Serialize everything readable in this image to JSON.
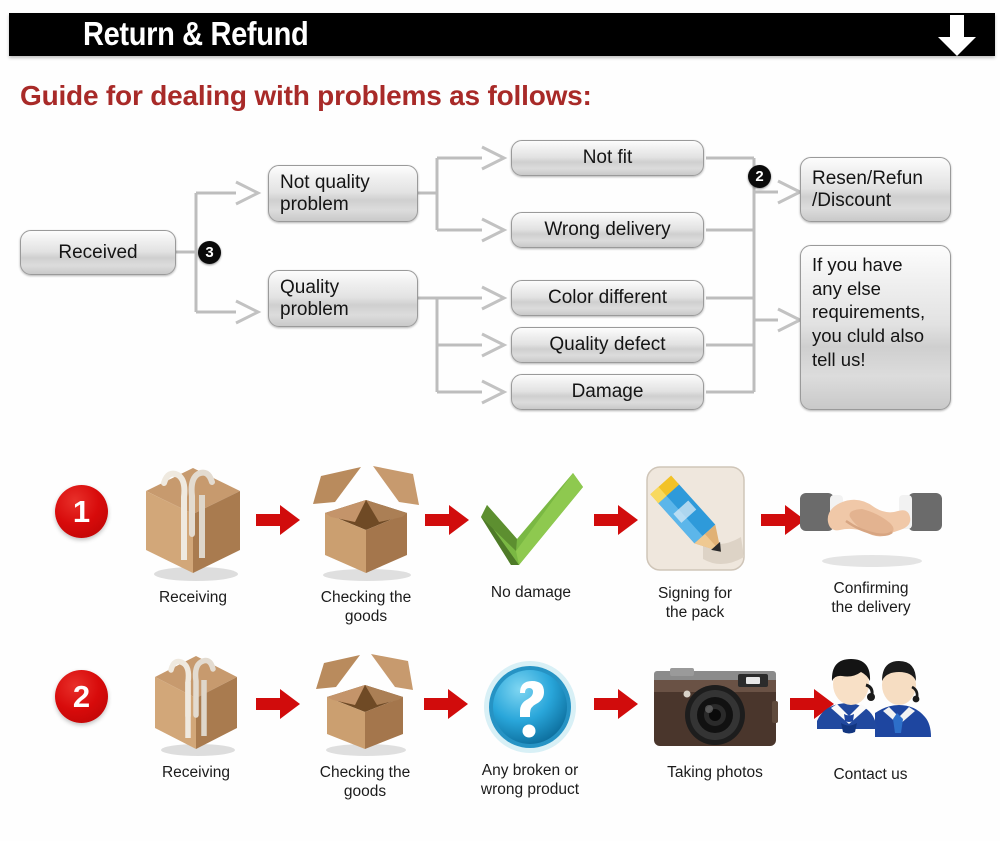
{
  "header": {
    "title": "Return & Refund",
    "arrow_icon": "arrow-down-icon"
  },
  "guide": {
    "heading": "Guide for dealing with problems as follows:",
    "heading_color": "#a82a28"
  },
  "flowchart": {
    "nodes": {
      "received": "Received",
      "not_quality_problem": "Not quality\nproblem",
      "quality_problem": "Quality\nproblem",
      "not_fit": "Not fit",
      "wrong_delivery": "Wrong delivery",
      "color_different": "Color different",
      "quality_defect": "Quality defect",
      "damage": "Damage",
      "resend_refund_discount": "Resen/Refun\n/Discount",
      "else_requirements": "If you have\nany else\nrequirements,\nyou cluld also\ntell us!"
    },
    "badges": {
      "split_badge": "3",
      "outcome_badge": "2"
    }
  },
  "process_rows": [
    {
      "number": "1",
      "steps": [
        {
          "icon": "closed-box-icon",
          "label": "Receiving"
        },
        {
          "icon": "open-box-icon",
          "label": "Checking the\ngoods"
        },
        {
          "icon": "green-check-icon",
          "label": "No damage"
        },
        {
          "icon": "pencil-signing-icon",
          "label": "Signing for\nthe pack"
        },
        {
          "icon": "handshake-icon",
          "label": "Confirming\nthe delivery"
        }
      ]
    },
    {
      "number": "2",
      "steps": [
        {
          "icon": "closed-box-icon",
          "label": "Receiving"
        },
        {
          "icon": "open-box-icon",
          "label": "Checking the\ngoods"
        },
        {
          "icon": "question-mark-icon",
          "label": "Any broken or\nwrong product"
        },
        {
          "icon": "camera-icon",
          "label": "Taking photos"
        },
        {
          "icon": "support-agents-icon",
          "label": "Contact us"
        }
      ]
    }
  ],
  "colors": {
    "header_bg": "#000000",
    "header_text": "#ffffff",
    "accent_red": "#d10c0c",
    "heading_red": "#a82a28",
    "box_border": "#9a9a9a",
    "connector": "#b8b8b8"
  }
}
